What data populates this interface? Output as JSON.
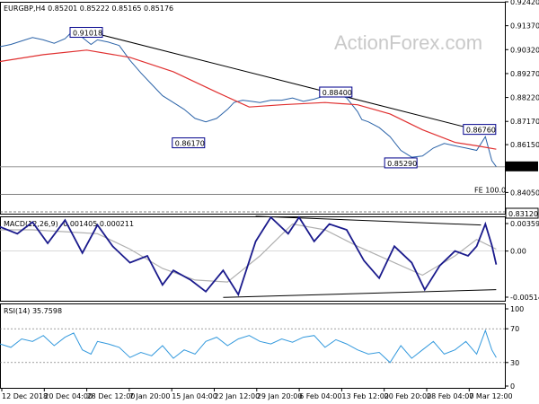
{
  "header": {
    "symbol_line": "EURGBP,H4  0.85201 0.85222 0.85165 0.85176",
    "watermark": "ActionForex.com"
  },
  "colors": {
    "price": "#2b63a8",
    "ema": "#e03030",
    "trendline": "#000000",
    "macd": "#1a1a8c",
    "signal": "#b0b0b0",
    "rsi": "#3399dd",
    "grid": "#c0c0c0"
  },
  "chart_data": [
    {
      "type": "line",
      "panel": "price",
      "title": "EURGBP,H4",
      "ohlc_last": {
        "open": 0.85201,
        "high": 0.85222,
        "low": 0.85165,
        "close": 0.85176
      },
      "ylim": [
        0.8312,
        0.9242
      ],
      "y_ticks": [
        "0.92420",
        "0.91370",
        "0.90320",
        "0.89270",
        "0.88220",
        "0.87170",
        "0.86150",
        "0.85176",
        "0.84050",
        "0.83120"
      ],
      "x_ticks": [
        "12 Dec 2018",
        "20 Dec 04:00",
        "28 Dec 12:00",
        "7 Jan 20:00",
        "15 Jan 04:00",
        "22 Jan 12:00",
        "29 Jan 20:00",
        "6 Feb 04:00",
        "13 Feb 12:00",
        "20 Feb 20:00",
        "28 Feb 04:00",
        "7 Mar 12:00"
      ],
      "series": [
        {
          "x": [
            0,
            5,
            10,
            15,
            20,
            25,
            30,
            34,
            38,
            42,
            45,
            50,
            55,
            60,
            65,
            70,
            75,
            80,
            85,
            90,
            95,
            100,
            105,
            108,
            112,
            116,
            120,
            125,
            130,
            135,
            140,
            145,
            150,
            155,
            160,
            165,
            167,
            170,
            175,
            180,
            185,
            190,
            195,
            200,
            205,
            210,
            215,
            220,
            224,
            227,
            229
          ],
          "values": [
            0.9045,
            0.9055,
            0.907,
            0.9085,
            0.9075,
            0.906,
            0.908,
            0.9118,
            0.9085,
            0.9055,
            0.9075,
            0.9065,
            0.905,
            0.8985,
            0.893,
            0.888,
            0.883,
            0.88,
            0.877,
            0.873,
            0.8715,
            0.873,
            0.877,
            0.88,
            0.881,
            0.8805,
            0.88,
            0.881,
            0.881,
            0.882,
            0.8805,
            0.8815,
            0.883,
            0.884,
            0.882,
            0.876,
            0.8725,
            0.8715,
            0.869,
            0.865,
            0.859,
            0.856,
            0.8565,
            0.86,
            0.862,
            0.861,
            0.86,
            0.859,
            0.865,
            0.8545,
            0.8518
          ]
        },
        {
          "x": [
            0,
            20,
            40,
            60,
            80,
            100,
            115,
            130,
            150,
            165,
            180,
            195,
            210,
            220,
            229
          ],
          "values": [
            0.898,
            0.901,
            0.903,
            0.8998,
            0.8935,
            0.8845,
            0.878,
            0.879,
            0.88,
            0.879,
            0.875,
            0.868,
            0.8625,
            0.861,
            0.8595
          ]
        }
      ],
      "annotations": [
        "0.91018",
        "0.86170",
        "0.88400",
        "0.86760",
        "0.85290",
        "FE 100.0"
      ]
    },
    {
      "type": "line",
      "panel": "macd",
      "title": "MACD(12,26,9) -0.001405 0.000211",
      "ylim": [
        -0.005146,
        0.003592
      ],
      "y_ticks": [
        "0.003592",
        "0.00",
        "-0.005146"
      ],
      "series": [
        {
          "x": [
            0,
            8,
            15,
            22,
            30,
            38,
            45,
            52,
            60,
            68,
            75,
            80,
            88,
            95,
            103,
            110,
            118,
            125,
            133,
            138,
            145,
            152,
            160,
            168,
            175,
            182,
            190,
            196,
            203,
            210,
            216,
            220,
            224,
            227,
            229
          ],
          "values": [
            0.0025,
            0.0018,
            0.003,
            0.0008,
            0.0032,
            -0.0002,
            0.0027,
            0.0005,
            -0.0012,
            -0.0005,
            -0.0035,
            -0.002,
            -0.003,
            -0.0042,
            -0.002,
            -0.0045,
            0.001,
            0.0035,
            0.0018,
            0.0035,
            0.001,
            0.0028,
            0.0022,
            -0.001,
            -0.0028,
            0.0005,
            -0.0012,
            -0.004,
            -0.0015,
            0.0,
            -0.0005,
            0.0005,
            0.0028,
            0.0006,
            -0.0014
          ]
        },
        {
          "x": [
            0,
            15,
            30,
            45,
            60,
            75,
            90,
            105,
            120,
            135,
            150,
            165,
            180,
            195,
            210,
            220,
            229
          ],
          "values": [
            0.0022,
            0.0022,
            0.002,
            0.0018,
            0.0002,
            -0.0018,
            -0.003,
            -0.0032,
            -0.0005,
            0.0028,
            0.0022,
            0.0005,
            -0.001,
            -0.0025,
            -0.0005,
            0.0012,
            0.0002
          ]
        }
      ]
    },
    {
      "type": "line",
      "panel": "rsi",
      "title": "RSI(14) 35.7598",
      "ylim": [
        0,
        100
      ],
      "y_ticks": [
        "100",
        "70",
        "30",
        "0"
      ],
      "series": [
        {
          "x": [
            0,
            5,
            10,
            15,
            20,
            25,
            30,
            34,
            38,
            42,
            45,
            50,
            55,
            60,
            65,
            70,
            75,
            80,
            85,
            90,
            95,
            100,
            105,
            110,
            115,
            120,
            125,
            130,
            135,
            140,
            145,
            150,
            155,
            160,
            165,
            170,
            175,
            180,
            185,
            190,
            195,
            200,
            205,
            210,
            215,
            220,
            224,
            227,
            229
          ],
          "values": [
            52,
            48,
            58,
            55,
            62,
            50,
            60,
            65,
            45,
            40,
            55,
            52,
            48,
            36,
            42,
            38,
            50,
            35,
            45,
            40,
            55,
            60,
            50,
            58,
            62,
            55,
            52,
            58,
            54,
            60,
            62,
            48,
            57,
            52,
            45,
            40,
            42,
            30,
            50,
            35,
            45,
            55,
            40,
            45,
            55,
            40,
            68,
            45,
            36
          ]
        }
      ]
    }
  ]
}
